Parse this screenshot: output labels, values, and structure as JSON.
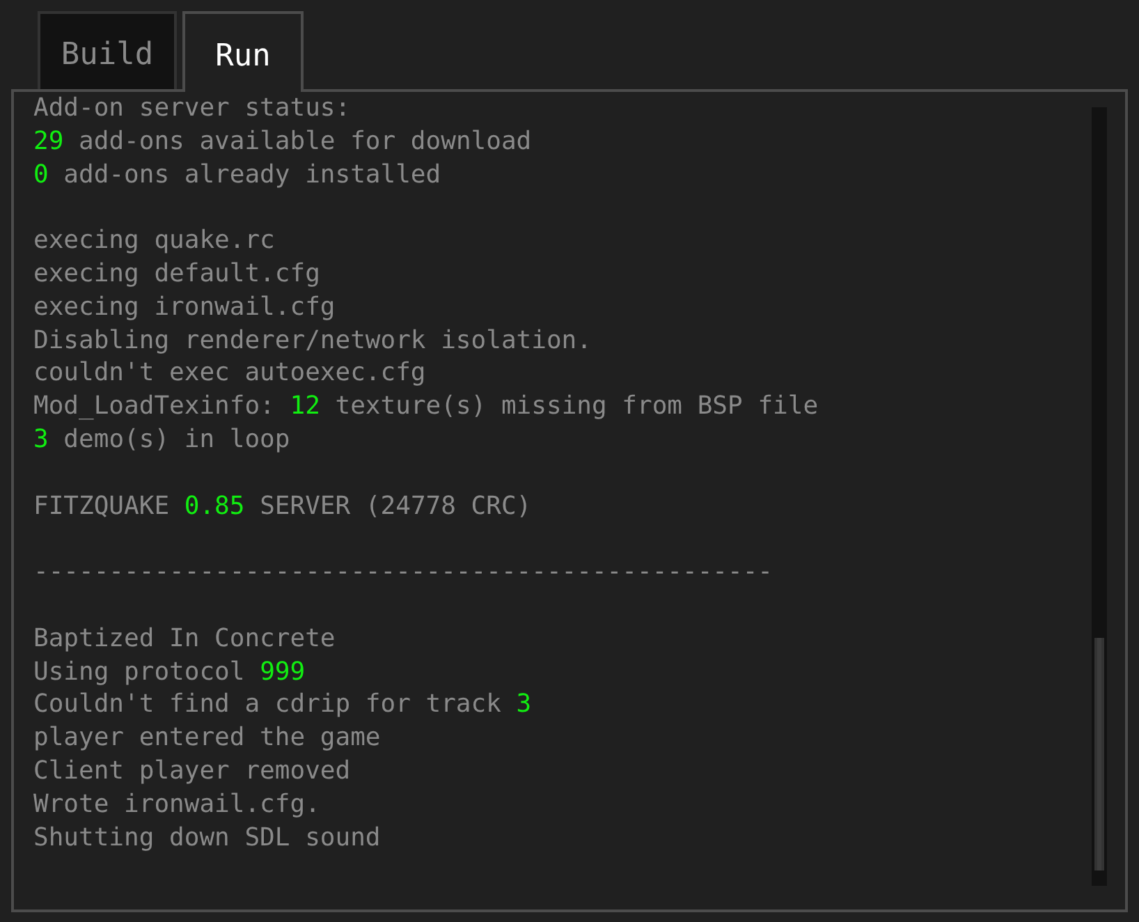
{
  "tabs": [
    {
      "label": "Build",
      "selected": false
    },
    {
      "label": "Run",
      "selected": true
    }
  ],
  "console": {
    "blocks": [
      {
        "lines": [
          [
            {
              "kind": "text",
              "text": "Add-on server status:"
            }
          ],
          [
            {
              "kind": "number",
              "text": "29"
            },
            {
              "kind": "text",
              "text": " add-ons available for download"
            }
          ],
          [
            {
              "kind": "number",
              "text": "0"
            },
            {
              "kind": "text",
              "text": " add-ons already installed"
            }
          ]
        ]
      },
      {
        "lines": [
          [
            {
              "kind": "text",
              "text": "execing quake.rc"
            }
          ],
          [
            {
              "kind": "text",
              "text": "execing default.cfg"
            }
          ],
          [
            {
              "kind": "text",
              "text": "execing ironwail.cfg"
            }
          ],
          [
            {
              "kind": "text",
              "text": "Disabling renderer/network isolation."
            }
          ],
          [
            {
              "kind": "text",
              "text": "couldn't exec autoexec.cfg"
            }
          ],
          [
            {
              "kind": "text",
              "text": "Mod_LoadTexinfo: "
            },
            {
              "kind": "number",
              "text": "12"
            },
            {
              "kind": "text",
              "text": " texture(s) missing from BSP file"
            }
          ],
          [
            {
              "kind": "number",
              "text": "3"
            },
            {
              "kind": "text",
              "text": " demo(s) in loop"
            }
          ]
        ]
      },
      {
        "lines": [
          [
            {
              "kind": "text",
              "text": "FITZQUAKE "
            },
            {
              "kind": "number",
              "text": "0.85"
            },
            {
              "kind": "text",
              "text": " SERVER (24778 CRC)"
            }
          ]
        ]
      },
      {
        "lines": [
          [
            {
              "kind": "text",
              "text": "-------------------------------------------------"
            }
          ]
        ]
      },
      {
        "lines": [
          [
            {
              "kind": "text",
              "text": "Baptized In Concrete"
            }
          ],
          [
            {
              "kind": "text",
              "text": "Using protocol "
            },
            {
              "kind": "number",
              "text": "999"
            }
          ],
          [
            {
              "kind": "text",
              "text": "Couldn't find a cdrip for track "
            },
            {
              "kind": "number",
              "text": "3"
            }
          ],
          [
            {
              "kind": "text",
              "text": "player entered the game"
            }
          ],
          [
            {
              "kind": "text",
              "text": "Client player removed"
            }
          ],
          [
            {
              "kind": "text",
              "text": "Wrote ironwail.cfg."
            }
          ],
          [
            {
              "kind": "text",
              "text": "Shutting down SDL sound"
            }
          ]
        ]
      }
    ]
  }
}
